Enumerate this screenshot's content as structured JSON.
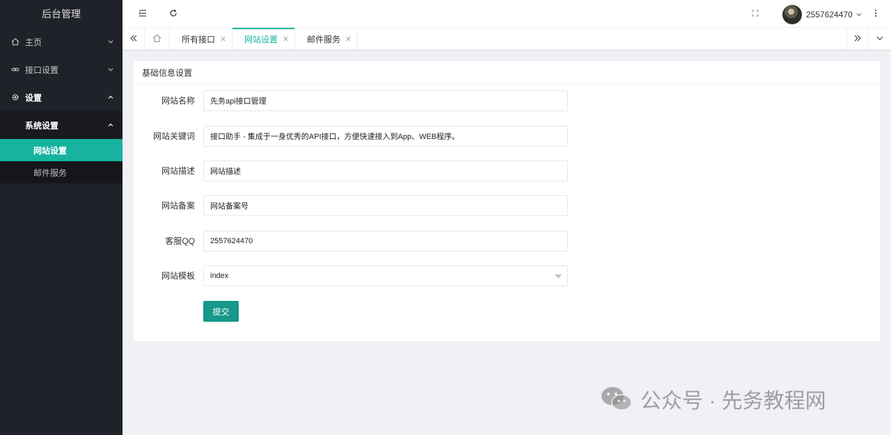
{
  "sidebar": {
    "logo": "后台管理",
    "items": [
      {
        "label": "主页"
      },
      {
        "label": "接口设置"
      },
      {
        "label": "设置"
      }
    ],
    "submenu": {
      "label": "系统设置"
    },
    "leaves": [
      {
        "label": "网站设置"
      },
      {
        "label": "邮件服务"
      }
    ]
  },
  "header": {
    "username": "2557624470"
  },
  "tabs": [
    {
      "label": "所有接口"
    },
    {
      "label": "网站设置"
    },
    {
      "label": "邮件服务"
    }
  ],
  "card": {
    "title": "基础信息设置",
    "fields": [
      {
        "label": "网站名称",
        "value": "先务api接口管理"
      },
      {
        "label": "网站关键词",
        "value": "接口助手 - 集成于一身优秀的API接口，方便快速接入到App、WEB程序。"
      },
      {
        "label": "网站描述",
        "value": "网站描述"
      },
      {
        "label": "网站备案",
        "value": "网站备案号"
      },
      {
        "label": "客服QQ",
        "value": "2557624470"
      },
      {
        "label": "网站模板",
        "value": "index"
      }
    ],
    "submit": "提交"
  },
  "watermark": "公众号 · 先务教程网",
  "colors": {
    "accent": "#16b4a0",
    "button": "#16988a",
    "sidebar": "#20222a"
  },
  "icons": [
    "home-icon",
    "link-icon",
    "gear-icon",
    "menu-fold-icon",
    "refresh-icon",
    "fullscreen-icon",
    "more-icon"
  ]
}
